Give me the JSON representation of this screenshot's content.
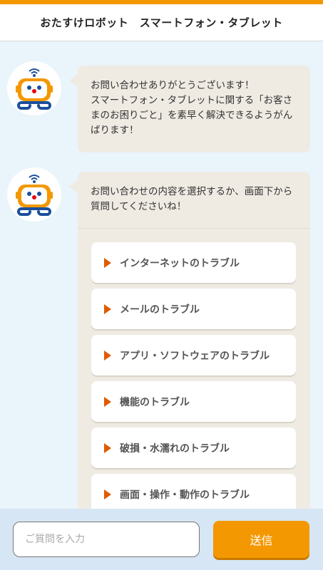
{
  "header": {
    "title": "おたすけロボット　スマートフォン・タブレット"
  },
  "colors": {
    "accent": "#f39800",
    "arrow": "#e05a00",
    "bubble": "#efebe3",
    "background": "#eaf4fb"
  },
  "messages": [
    {
      "avatar_icon": "robot-icon",
      "text": "お問い合わせありがとうございます！\nスマートフォン・タブレットに関する「お客さまのお困りごと」を素早く解決できるようがんばります！"
    },
    {
      "avatar_icon": "robot-icon",
      "text": "お問い合わせの内容を選択するか、画面下から質問してくださいね！"
    }
  ],
  "options": [
    {
      "label": "インターネットのトラブル"
    },
    {
      "label": "メールのトラブル"
    },
    {
      "label": "アプリ・ソフトウェアのトラブル"
    },
    {
      "label": "機能のトラブル"
    },
    {
      "label": "破損・水濡れのトラブル"
    },
    {
      "label": "画面・操作・動作のトラブル"
    }
  ],
  "footer": {
    "input_placeholder": "ご質問を入力",
    "input_value": "",
    "send_label": "送信"
  }
}
